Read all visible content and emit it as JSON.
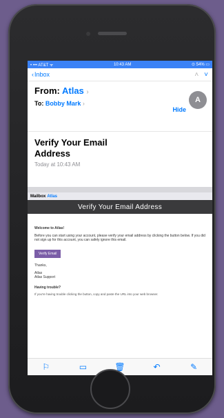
{
  "status_bar": {
    "left": "• ••• AT&T  ᯤ",
    "center": "10:43 AM",
    "right": "⊙ 54% ▭"
  },
  "nav": {
    "back_label": "Inbox",
    "up_icon": "chevron-up-icon",
    "down_icon": "chevron-down-icon"
  },
  "header": {
    "from_label": "From:",
    "sender_name": "Atlas",
    "to_label": "To:",
    "recipient_name": "Bobby Mark",
    "hide_label": "Hide",
    "avatar_initial": "A"
  },
  "subject": {
    "title": "Verify Your Email Address",
    "date": "Today at 10:43 AM"
  },
  "mailbox": {
    "label": "Mailbox",
    "tag": "Atlas"
  },
  "banner": {
    "text": "Verify Your Email Address"
  },
  "body": {
    "greeting": "Welcome to Atlas!",
    "paragraph": "Before you can start using your account, please verify your email address by clicking the button below. If you did not sign up for this account, you can safely ignore this email.",
    "button_label": "Verify Email",
    "thanks": "Thanks,",
    "signature_line1": "Atlas",
    "signature_line2": "Atlas Support",
    "footer_title": "Having trouble?",
    "footer_text": "If you're having trouble clicking the button, copy and paste the URL into your web browser."
  },
  "toolbar": {
    "icons": [
      "flag-icon",
      "folder-icon",
      "trash-icon",
      "reply-icon",
      "compose-icon"
    ]
  },
  "colors": {
    "background": "#6d5d8c",
    "accent": "#007aff",
    "button": "#7b5ea7"
  }
}
